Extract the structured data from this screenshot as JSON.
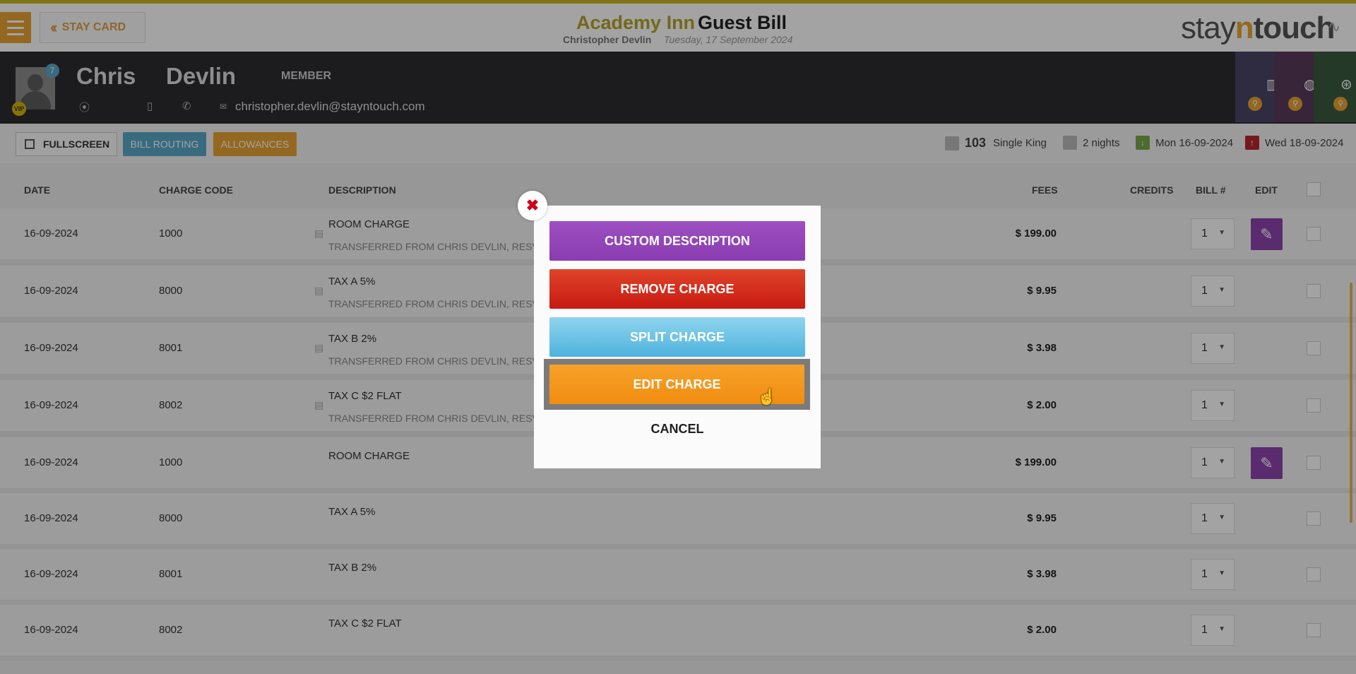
{
  "header": {
    "stay_card_label": "STAY CARD",
    "hotel_name": "Academy Inn",
    "page_title": "Guest Bill",
    "guest_full_name": "Christopher Devlin",
    "business_date": "Tuesday, 17 September 2024",
    "logo_part1": "stay",
    "logo_part2": "n",
    "logo_part3": "touch"
  },
  "guest": {
    "first_name": "Chris",
    "last_name": "Devlin",
    "membership": "MEMBER",
    "vip_label": "VIP",
    "badge_count": "7",
    "email": "christopher.devlin@stayntouch.com"
  },
  "toolbar": {
    "fullscreen_label": "FULLSCREEN",
    "bill_routing_label": "BILL ROUTING",
    "allowances_label": "ALLOWANCES",
    "room_number": "103",
    "room_type": "Single King",
    "nights": "2 nights",
    "arrival": "Mon 16-09-2024",
    "departure": "Wed 18-09-2024"
  },
  "table": {
    "headers": {
      "date": "DATE",
      "charge_code": "CHARGE CODE",
      "description": "DESCRIPTION",
      "fees": "FEES",
      "credits": "CREDITS",
      "bill_no": "BILL #",
      "edit": "EDIT"
    },
    "rows": [
      {
        "date": "16-09-2024",
        "code": "1000",
        "desc": "ROOM CHARGE",
        "sub": "TRANSFERRED FROM CHRIS DEVLIN, RESV #",
        "fee": "$ 199.00",
        "bill": "1"
      },
      {
        "date": "16-09-2024",
        "code": "8000",
        "desc": "TAX A 5%",
        "sub": "TRANSFERRED FROM CHRIS DEVLIN, RESV #",
        "fee": "$ 9.95",
        "bill": "1"
      },
      {
        "date": "16-09-2024",
        "code": "8001",
        "desc": "TAX B 2%",
        "sub": "TRANSFERRED FROM CHRIS DEVLIN, RESV #",
        "fee": "$ 3.98",
        "bill": "1"
      },
      {
        "date": "16-09-2024",
        "code": "8002",
        "desc": "TAX C $2 FLAT",
        "sub": "TRANSFERRED FROM CHRIS DEVLIN, RESV #",
        "fee": "$ 2.00",
        "bill": "1"
      },
      {
        "date": "16-09-2024",
        "code": "1000",
        "desc": "ROOM CHARGE",
        "sub": "",
        "fee": "$ 199.00",
        "bill": "1"
      },
      {
        "date": "16-09-2024",
        "code": "8000",
        "desc": "TAX A 5%",
        "sub": "",
        "fee": "$ 9.95",
        "bill": "1"
      },
      {
        "date": "16-09-2024",
        "code": "8001",
        "desc": "TAX B 2%",
        "sub": "",
        "fee": "$ 3.98",
        "bill": "1"
      },
      {
        "date": "16-09-2024",
        "code": "8002",
        "desc": "TAX C $2 FLAT",
        "sub": "",
        "fee": "$ 2.00",
        "bill": "1"
      }
    ]
  },
  "modal": {
    "custom_description_label": "CUSTOM DESCRIPTION",
    "remove_charge_label": "REMOVE CHARGE",
    "split_charge_label": "SPLIT CHARGE",
    "edit_charge_label": "EDIT CHARGE",
    "cancel_label": "CANCEL"
  },
  "colors": {
    "brand_gold": "#b5a329",
    "accent_orange": "#e8a333",
    "purple": "#8e44ad",
    "red": "#d0021b",
    "blue": "#5aa8c8"
  }
}
